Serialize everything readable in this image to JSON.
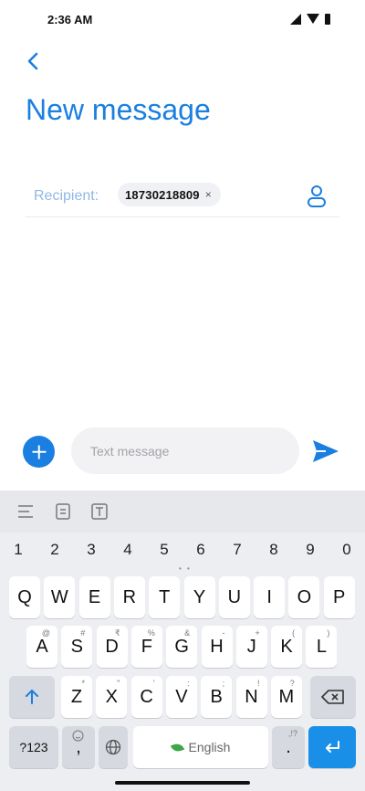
{
  "status_bar": {
    "time": "2:36 AM"
  },
  "header": {
    "title": "New message"
  },
  "recipient": {
    "label": "Recipient:",
    "number": "18730218809",
    "remove_symbol": "×"
  },
  "compose": {
    "placeholder": "Text message"
  },
  "keyboard": {
    "numbers": [
      "1",
      "2",
      "3",
      "4",
      "5",
      "6",
      "7",
      "8",
      "9",
      "0"
    ],
    "row1": [
      "Q",
      "W",
      "E",
      "R",
      "T",
      "Y",
      "U",
      "I",
      "O",
      "P"
    ],
    "row2": [
      {
        "k": "A",
        "h": "@"
      },
      {
        "k": "S",
        "h": "#"
      },
      {
        "k": "D",
        "h": "₹"
      },
      {
        "k": "F",
        "h": "%"
      },
      {
        "k": "G",
        "h": "&"
      },
      {
        "k": "H",
        "h": "-"
      },
      {
        "k": "J",
        "h": "+"
      },
      {
        "k": "K",
        "h": "("
      },
      {
        "k": "L",
        "h": ")"
      }
    ],
    "row3": [
      {
        "k": "Z",
        "h": "*"
      },
      {
        "k": "X",
        "h": "\""
      },
      {
        "k": "C",
        "h": "'"
      },
      {
        "k": "V",
        "h": ":"
      },
      {
        "k": "B",
        "h": ";"
      },
      {
        "k": "N",
        "h": "!"
      },
      {
        "k": "M",
        "h": "?"
      }
    ],
    "symbols_label": "?123",
    "comma": ",",
    "space_label": "English",
    "period": ".",
    "period_hint": ",!?"
  }
}
